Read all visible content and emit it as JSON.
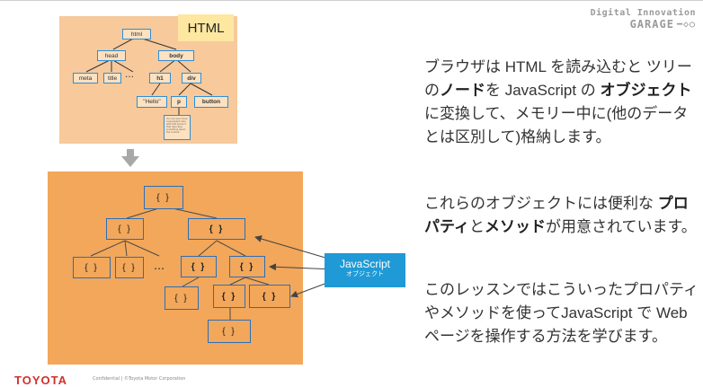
{
  "brand": {
    "line1": "Digital Innovation",
    "line2": "GARAGE"
  },
  "html_tree": {
    "label": "HTML",
    "nodes": {
      "html": "html",
      "head": "head",
      "body": "body",
      "meta": "meta",
      "title": "title",
      "dots": "…",
      "h1": "h1",
      "div": "div",
      "hello": "\"Hello\"",
      "p": "p",
      "button": "button"
    },
    "note": "You can even have a paragraph here with text inside it that describes something about the content."
  },
  "object_tree": {
    "node_label": "{ }",
    "dots": "…"
  },
  "callout": {
    "title": "JavaScript",
    "subtitle": "オブジェクト"
  },
  "paragraphs": {
    "p1": {
      "a": "ブラウザは HTML を読み込むと ツリーの",
      "b1": "ノード",
      "c": "を JavaScript の ",
      "b2": "オブジェクト",
      "d": "に変換して、メモリー中に(他のデータとは区別して)格納します。"
    },
    "p2": {
      "a": "これらのオブジェクトには便利な ",
      "b1": "プロパティ",
      "c": "と",
      "b2": "メソッド",
      "d": "が用意されています。"
    },
    "p3": {
      "a": "このレッスンではこういったプロパティやメソッドを使ってJavaScript で Web ページを操作する方法を学びます。"
    }
  },
  "footer": {
    "logo": "TOYOTA",
    "text": "Confidential | ©Toyota Motor Corporation"
  },
  "colors": {
    "html_panel": "#f7c99b",
    "object_panel": "#f2a75a",
    "callout": "#1f9ad6",
    "node_border": "#2e8fd6"
  }
}
